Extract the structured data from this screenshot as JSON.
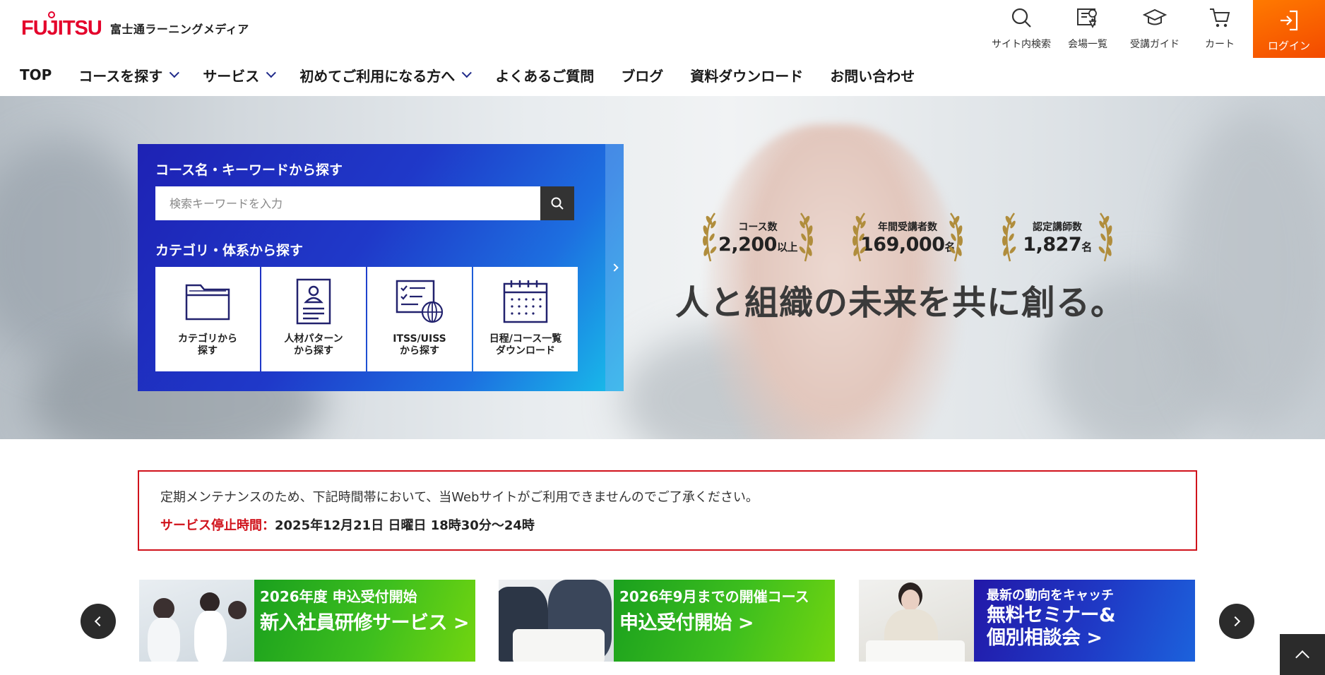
{
  "header": {
    "logo_brand": "FUJITSU",
    "logo_sub": "富士通ラーニングメディア",
    "utility": {
      "search": "サイト内検索",
      "venue": "会場一覧",
      "guide": "受講ガイド",
      "cart": "カート",
      "login": "ログイン"
    },
    "nav": [
      {
        "label": "TOP",
        "dropdown": false
      },
      {
        "label": "コースを探す",
        "dropdown": true
      },
      {
        "label": "サービス",
        "dropdown": true
      },
      {
        "label": "初めてご利用になる方へ",
        "dropdown": true
      },
      {
        "label": "よくあるご質問",
        "dropdown": false
      },
      {
        "label": "ブログ",
        "dropdown": false
      },
      {
        "label": "資料ダウンロード",
        "dropdown": false
      },
      {
        "label": "お問い合わせ",
        "dropdown": false
      }
    ]
  },
  "hero": {
    "search_title": "コース名・キーワードから探す",
    "search_placeholder": "検索キーワードを入力",
    "category_title": "カテゴリ・体系から探す",
    "categories": [
      {
        "line1": "カテゴリから",
        "line2": "探す",
        "icon": "folder-icon"
      },
      {
        "line1": "人材パターン",
        "line2": "から探す",
        "icon": "profile-card-icon"
      },
      {
        "line1": "ITSS/UISS",
        "line2": "から探す",
        "icon": "checklist-globe-icon"
      },
      {
        "line1": "日程/コース一覧",
        "line2": "ダウンロード",
        "icon": "calendar-icon"
      }
    ],
    "stats": [
      {
        "label": "コース数",
        "value": "2,200",
        "unit": "以上"
      },
      {
        "label": "年間受講者数",
        "value": "169,000",
        "unit": "名"
      },
      {
        "label": "認定講師数",
        "value": "1,827",
        "unit": "名"
      }
    ],
    "tagline": "人と組織の未来を共に創る。"
  },
  "notice": {
    "line1": "定期メンテナンスのため、下記時間帯において、当Webサイトがご利用できませんのでご了承ください。",
    "label": "サービス停止時間：",
    "time": "2025年12月21日 日曜日 18時30分～24時"
  },
  "banners": [
    {
      "line1": "2026年度 申込受付開始",
      "line2": "新入社員研修サービス >"
    },
    {
      "line1": "2026年9月までの開催コース",
      "line2": "申込受付開始 >"
    },
    {
      "line1": "最新の動向をキャッチ",
      "line2": "無料セミナー&",
      "line3": "個別相談会 >"
    }
  ],
  "colors": {
    "brand_red": "#e4002b",
    "login_orange": "#f36100",
    "panel_blue": "#1f39c9",
    "banner_green": "#3ebf1e",
    "banner_blue": "#1f3ac6",
    "notice_red": "#d0121b"
  }
}
